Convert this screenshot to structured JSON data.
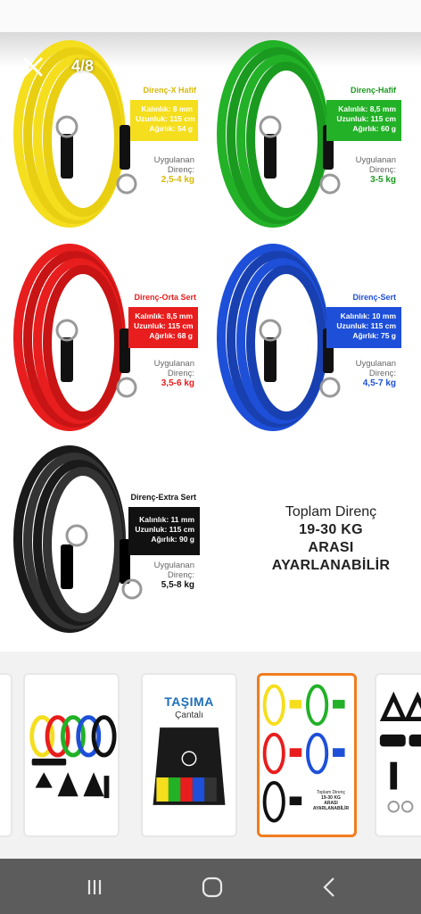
{
  "gallery": {
    "counter": "4/8"
  },
  "bands": [
    {
      "title": "Direnç-X Hafif",
      "thickness": "Kalınlık: 8 mm",
      "length": "Uzunluk: 115 cm",
      "weight": "Ağırlık: 54 g",
      "res_label_1": "Uygulanan",
      "res_label_2": "Direnç:",
      "res_value": "2,5-4 kg",
      "color": "#f5de1d",
      "accent": "#d8b90a"
    },
    {
      "title": "Direnç-Hafif",
      "thickness": "Kalınlık: 8,5 mm",
      "length": "Uzunluk: 115 cm",
      "weight": "Ağırlık: 60 g",
      "res_label_1": "Uygulanan",
      "res_label_2": "Direnç:",
      "res_value": "3-5 kg",
      "color": "#22b127",
      "accent": "#1a9a1f"
    },
    {
      "title": "Direnç-Orta Sert",
      "thickness": "Kalınlık: 8,5 mm",
      "length": "Uzunluk: 115 cm",
      "weight": "Ağırlık: 68 g",
      "res_label_1": "Uygulanan",
      "res_label_2": "Direnç:",
      "res_value": "3,5-6 kg",
      "color": "#e81d1d",
      "accent": "#e81d1d"
    },
    {
      "title": "Direnç-Sert",
      "thickness": "Kalınlık: 10 mm",
      "length": "Uzunluk: 115 cm",
      "weight": "Ağırlık: 75 g",
      "res_label_1": "Uygulanan",
      "res_label_2": "Direnç:",
      "res_value": "4,5-7 kg",
      "color": "#1d4fd8",
      "accent": "#1d4fd8"
    },
    {
      "title": "Direnç-Extra Sert",
      "thickness": "Kalınlık: 11 mm",
      "length": "Uzunluk: 115 cm",
      "weight": "Ağırlık: 90 g",
      "res_label_1": "Uygulanan",
      "res_label_2": "Direnç:",
      "res_value": "5,5-8 kg",
      "color": "#111111",
      "accent": "#111111"
    }
  ],
  "total": {
    "line1": "Toplam Direnç",
    "line2": "19-30 KG",
    "line3": "ARASI",
    "line4": "AYARLANABİLİR"
  },
  "thumbnails": {
    "bag_title": "TAŞIMA",
    "bag_sub": "Çantalı",
    "mini_total_1": "Toplam Direnç",
    "mini_total_2": "19-30 KG",
    "mini_total_3": "ARASI",
    "mini_total_4": "AYARLANABİLİR"
  },
  "colors": {
    "active_border": "#f07d1f",
    "navbar": "#5c5c5c"
  }
}
